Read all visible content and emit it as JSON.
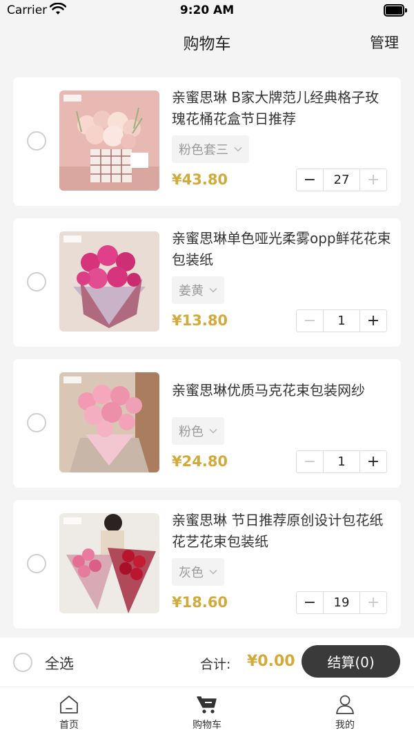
{
  "status_bar": {
    "carrier": "Carrier",
    "time": "9:20 AM"
  },
  "nav": {
    "title": "购物车",
    "manage_label": "管理"
  },
  "items": [
    {
      "title": "亲蜜思琳 B家大牌范儿经典格子玫瑰花桶花盒节日推荐",
      "variant": "粉色套三",
      "price": "¥43.80",
      "quantity": "27",
      "minus_enabled": true,
      "plus_enabled": false
    },
    {
      "title": "亲蜜思琳单色哑光柔雾opp鲜花花束包装纸",
      "variant": "姜黄",
      "price": "¥13.80",
      "quantity": "1",
      "minus_enabled": false,
      "plus_enabled": true
    },
    {
      "title": "亲蜜思琳优质马克花束包装网纱",
      "variant": "粉色",
      "price": "¥24.80",
      "quantity": "1",
      "minus_enabled": false,
      "plus_enabled": true
    },
    {
      "title": "亲蜜思琳 节日推荐原创设计包花纸花艺花束包装纸",
      "variant": "灰色",
      "price": "¥18.60",
      "quantity": "19",
      "minus_enabled": true,
      "plus_enabled": false
    }
  ],
  "stepper": {
    "minus": "−",
    "plus": "+"
  },
  "checkout": {
    "select_all": "全选",
    "total_label": "合计:",
    "total_value": "¥0.00",
    "button_label": "结算(0)"
  },
  "tabs": [
    {
      "label": "首页",
      "icon": "home-icon"
    },
    {
      "label": "购物车",
      "icon": "cart-icon",
      "active": true
    },
    {
      "label": "我的",
      "icon": "user-icon"
    }
  ],
  "colors": {
    "price": "#d2aa3c",
    "checkout_button": "#3a3a3a",
    "background": "#f4f4f4"
  }
}
